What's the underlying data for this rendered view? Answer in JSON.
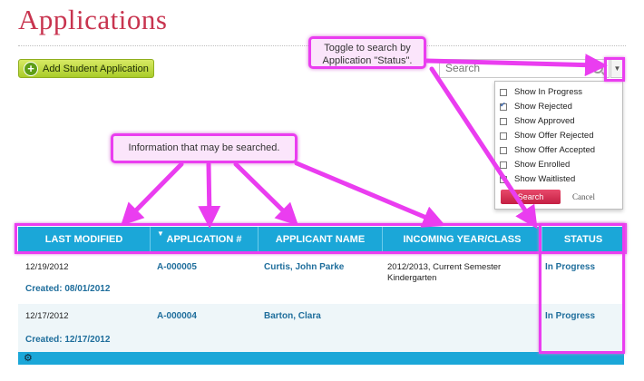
{
  "page": {
    "title": "Applications"
  },
  "toolbar": {
    "add_button_label": "Add Student Application"
  },
  "search": {
    "placeholder": "Search"
  },
  "dropdown": {
    "options": [
      {
        "label": "Show In Progress",
        "checked": false
      },
      {
        "label": "Show Rejected",
        "checked": true
      },
      {
        "label": "Show Approved",
        "checked": false
      },
      {
        "label": "Show Offer Rejected",
        "checked": false
      },
      {
        "label": "Show Offer Accepted",
        "checked": false
      },
      {
        "label": "Show Enrolled",
        "checked": false
      },
      {
        "label": "Show Waitlisted",
        "checked": true
      }
    ],
    "search_label": "Search",
    "cancel_label": "Cancel"
  },
  "table": {
    "columns": [
      "LAST MODIFIED",
      "APPLICATION #",
      "APPLICANT NAME",
      "INCOMING YEAR/CLASS",
      "STATUS"
    ],
    "rows": [
      {
        "last_modified": "12/19/2012",
        "created": "Created: 08/01/2012",
        "application": "A-000005",
        "applicant": "Curtis, John Parke",
        "year_line1": "2012/2013, Current Semester",
        "year_line2": "Kindergarten",
        "status": "In Progress"
      },
      {
        "last_modified": "12/17/2012",
        "created": "Created: 12/17/2012",
        "application": "A-000004",
        "applicant": "Barton, Clara",
        "year_line1": "",
        "year_line2": "",
        "status": "In Progress"
      }
    ]
  },
  "annotations": {
    "toggle_note": "Toggle to search by Application \"Status\".",
    "info_note": "Information that may be searched.",
    "color": "#ea3df0"
  },
  "colors": {
    "title": "#c8344f",
    "header": "#1ba7d8",
    "link": "#1f6e9c",
    "add_button": "#a9cc2a"
  }
}
